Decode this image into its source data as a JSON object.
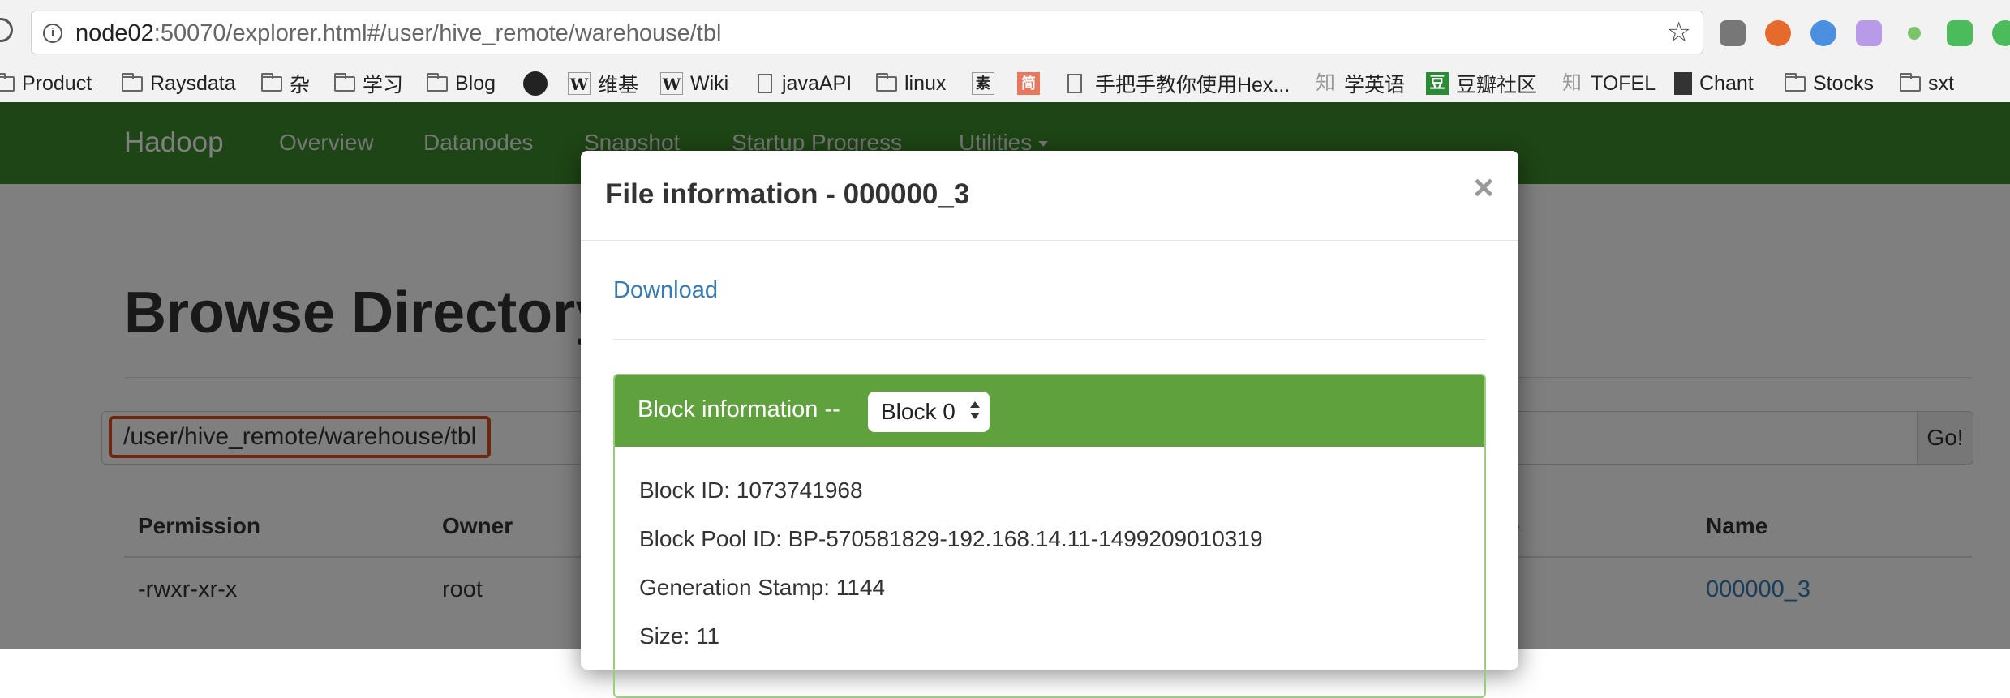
{
  "browser": {
    "url_host": "node02",
    "url_rest": ":50070/explorer.html#/user/hive_remote/warehouse/tbl",
    "bookmarks": [
      {
        "label": "Product",
        "icon": "folder-icon"
      },
      {
        "label": "Raysdata",
        "icon": "folder-icon"
      },
      {
        "label": "杂",
        "icon": "folder-icon"
      },
      {
        "label": "学习",
        "icon": "folder-icon"
      },
      {
        "label": "Blog",
        "icon": "folder-icon"
      },
      {
        "label": "",
        "icon": "github-icon"
      },
      {
        "label": "维基",
        "icon": "wikipedia-icon"
      },
      {
        "label": "Wiki",
        "icon": "wikipedia-icon"
      },
      {
        "label": "javaAPI",
        "icon": "document-icon"
      },
      {
        "label": "linux",
        "icon": "folder-icon"
      },
      {
        "label": "",
        "icon": "su-icon"
      },
      {
        "label": "",
        "icon": "jian-icon"
      },
      {
        "label": "手把手教你使用Hex...",
        "icon": "document-icon"
      },
      {
        "label": "学英语",
        "icon": "zhihu-icon"
      },
      {
        "label": "豆瓣社区",
        "icon": "douban-icon"
      },
      {
        "label": "TOFEL",
        "icon": "zhihu-icon"
      },
      {
        "label": "Chant",
        "icon": "chant-icon"
      },
      {
        "label": "Stocks",
        "icon": "folder-icon"
      },
      {
        "label": "sxt",
        "icon": "folder-icon"
      }
    ],
    "icon_glyphs": {
      "wikipedia": "W",
      "zhihu": "知",
      "douban": "豆",
      "su": "素",
      "jian": "简"
    }
  },
  "navbar": {
    "brand": "Hadoop",
    "items": [
      "Overview",
      "Datanodes",
      "Snapshot",
      "Startup Progress",
      "Utilities"
    ],
    "color": "#3d8b2a"
  },
  "page": {
    "title": "Browse Directory",
    "path_value": "/user/hive_remote/warehouse/tbl",
    "go_label": "Go!",
    "table": {
      "headers": {
        "permission": "Permission",
        "owner": "Owner",
        "size_partial": "e",
        "name": "Name"
      },
      "row": {
        "permission": "-rwxr-xr-x",
        "owner": "root",
        "name": "000000_3"
      }
    }
  },
  "modal": {
    "title": "File information - 000000_3",
    "close": "×",
    "download": "Download",
    "panel_title": "Block information --",
    "block_select": "Block 0",
    "lines": [
      "Block ID: 1073741968",
      "Block Pool ID: BP-570581829-192.168.14.11-1499209010319",
      "Generation Stamp: 1144",
      "Size: 11"
    ],
    "panel_color": "#5fa23d",
    "highlight_color": "#e04a1b"
  }
}
